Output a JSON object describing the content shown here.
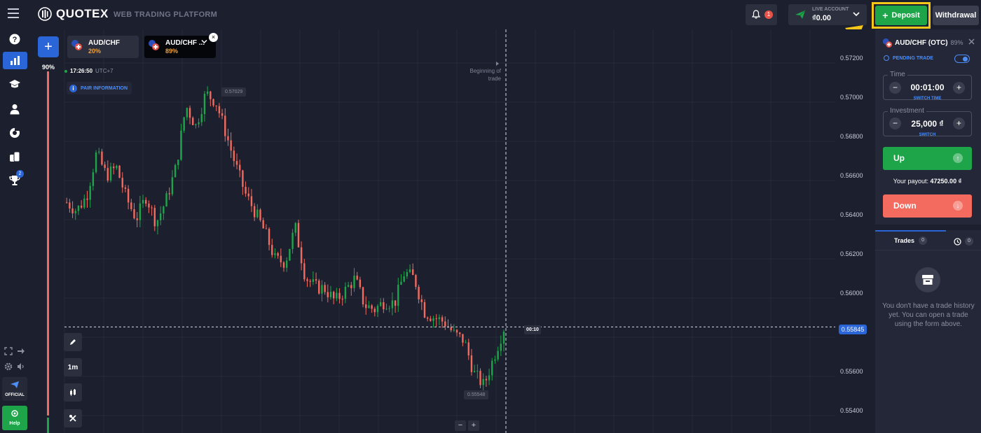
{
  "header": {
    "brand": "QUOTEX",
    "platform": "WEB TRADING PLATFORM",
    "notifications": "1",
    "account_label": "LIVE ACCOUNT",
    "account_balance": "₫0.00",
    "deposit_label": "Deposit",
    "withdraw_label": "Withdrawal"
  },
  "sidebar": {
    "trophy_badge": "2",
    "official_label": "OFFICIAL",
    "help_label": "Help",
    "icons": [
      "question-icon",
      "chart-icon",
      "education-icon",
      "user-icon",
      "pie-chart-icon",
      "coins-icon",
      "trophy-icon"
    ]
  },
  "chart": {
    "tabs": [
      {
        "name": "AUD/CHF",
        "payout": "20%"
      },
      {
        "name": "AUD/CHF ...",
        "payout": "89%"
      }
    ],
    "sentiment": "90%",
    "time": "17:26:50",
    "timezone": "UTC+7",
    "pair_info": "PAIR INFORMATION",
    "beginning": "Beginning of trade",
    "timeframe": "1m",
    "timer": "00:10",
    "high_tag": "0.57029",
    "low_tag": "0.55548",
    "current_price": "0.55845",
    "price_labels": [
      "0.57200",
      "0.57000",
      "0.56800",
      "0.56600",
      "0.56400",
      "0.56200",
      "0.56000",
      "0.55800",
      "0.55600",
      "0.55400"
    ],
    "sentiment_color_red": "#f36a5e",
    "sentiment_color_green": "#1fa549"
  },
  "panel": {
    "pair": "AUD/CHF (OTC)",
    "pair_payout": "89%",
    "pending": "PENDING TRADE",
    "time_label": "Time",
    "time_value": "00:01:00",
    "switch_time": "SWITCH TIME",
    "investment_label": "Investment",
    "investment_value": "25,000 ₫",
    "switch": "SWITCH",
    "up_label": "Up",
    "payout_label": "Your payout:",
    "payout_value": "47250.00 ₫",
    "down_label": "Down",
    "trades_label": "Trades",
    "trades_count": "0",
    "history_count": "0",
    "empty_text": "You don't have a trade history yet. You can open a trade using the form above."
  },
  "colors": {
    "bullish": "#1fa549",
    "bearish": "#f36a5e",
    "accent": "#2b66d9",
    "highlight": "#f6c619"
  },
  "chart_data": {
    "type": "candlestick",
    "pair": "AUD/CHF (OTC)",
    "timeframe": "1m",
    "ylim": [
      0.5533,
      0.5729
    ],
    "close_path": [
      0.5645,
      0.5641,
      0.5648,
      0.5669,
      0.5658,
      0.5662,
      0.5647,
      0.5637,
      0.5648,
      0.5635,
      0.5646,
      0.5662,
      0.5692,
      0.5682,
      0.5698,
      0.5694,
      0.5679,
      0.5663,
      0.5649,
      0.564,
      0.563,
      0.5617,
      0.5616,
      0.5633,
      0.5609,
      0.5604,
      0.5603,
      0.5597,
      0.5602,
      0.5608,
      0.5595,
      0.5593,
      0.5597,
      0.5596,
      0.5611,
      0.5608,
      0.5592,
      0.5589,
      0.5587,
      0.5581,
      0.5578,
      0.5562,
      0.5556,
      0.557,
      0.5584
    ],
    "high": 0.57029,
    "low": 0.55548,
    "current": 0.55845
  }
}
